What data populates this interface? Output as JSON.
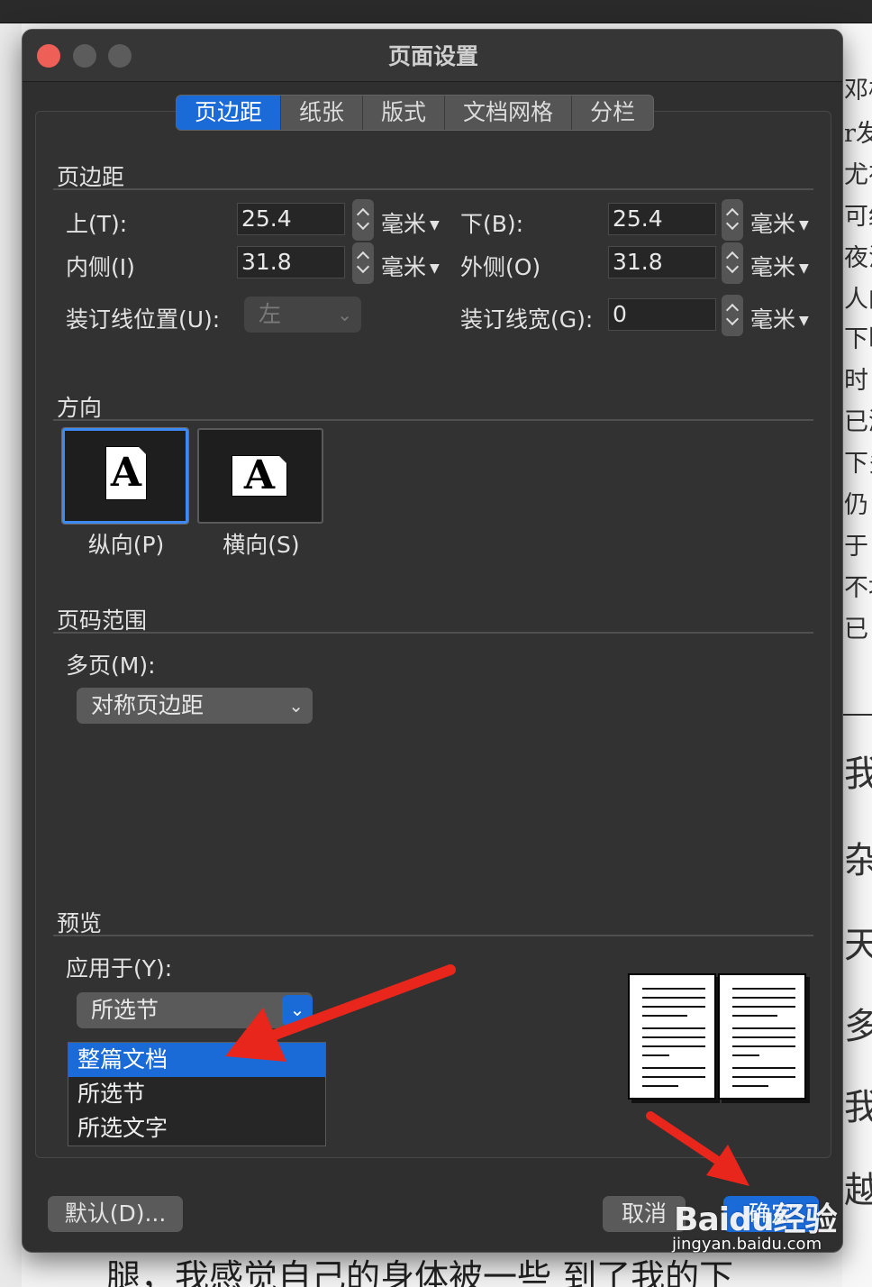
{
  "dialog": {
    "title": "页面设置",
    "tabs": [
      "页边距",
      "纸张",
      "版式",
      "文档网格",
      "分栏"
    ]
  },
  "margins": {
    "section": "页边距",
    "top_label": "上(T):",
    "top_value": "25.4",
    "bottom_label": "下(B):",
    "bottom_value": "25.4",
    "inside_label": "内侧(I)",
    "inside_value": "31.8",
    "outside_label": "外侧(O)",
    "outside_value": "31.8",
    "gutter_pos_label": "装订线位置(U):",
    "gutter_pos_value": "左",
    "gutter_width_label": "装订线宽(G):",
    "gutter_width_value": "0",
    "unit": "毫米"
  },
  "orientation": {
    "section": "方向",
    "portrait_label": "纵向(P)",
    "landscape_label": "横向(S)",
    "glyph": "A"
  },
  "pages": {
    "section": "页码范围",
    "multiple_label": "多页(M):",
    "multiple_value": "对称页边距"
  },
  "preview": {
    "section": "预览",
    "apply_label": "应用于(Y):",
    "apply_value": "所选节",
    "options": [
      "整篇文档",
      "所选节",
      "所选文字"
    ]
  },
  "buttons": {
    "default": "默认(D)...",
    "cancel": "取消",
    "ok": "确定"
  },
  "background_doc": {
    "right_chars_small": [
      "邓极",
      "r发",
      "尤在",
      "可约",
      "夜涛",
      "人的",
      "下断",
      "时",
      "已游",
      "下多",
      "仍",
      "于",
      "不地",
      "已"
    ],
    "right_chars_large": [
      "我",
      "杂",
      "天",
      "多",
      "我",
      "越"
    ],
    "bottom_line": "腿，我感觉自己的身体被一些   到了我的下"
  },
  "watermark": {
    "main": "Baidu经验",
    "sub": "jingyan.baidu.com"
  },
  "colors": {
    "accent": "#1a6ad8",
    "arrow": "#e8261c"
  }
}
